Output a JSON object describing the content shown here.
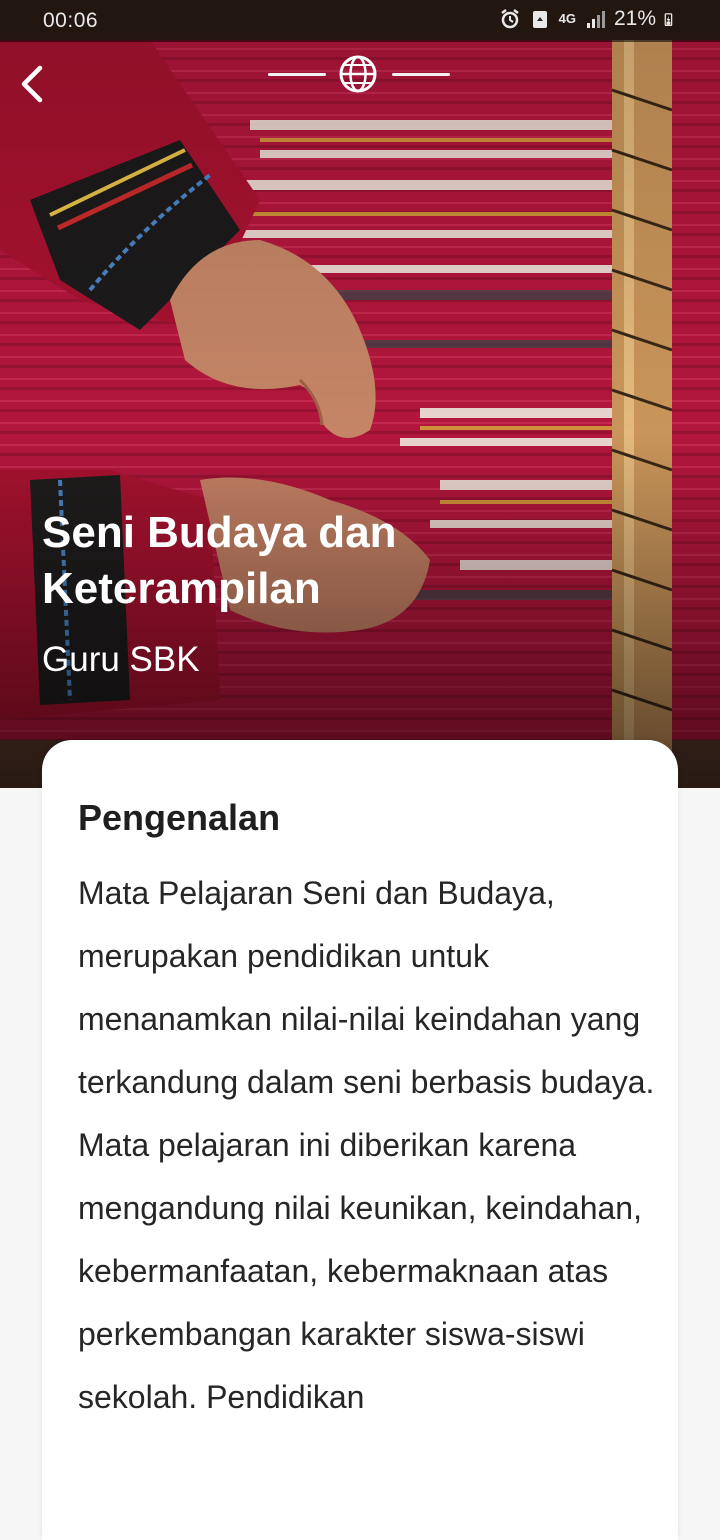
{
  "status_bar": {
    "time": "00:06",
    "network": "4G",
    "battery": "21%"
  },
  "header": {
    "back_icon": "chevron-left-icon",
    "language_icon": "globe-icon"
  },
  "hero": {
    "title": "Seni Budaya dan Keterampilan",
    "subtitle": "Guru SBK",
    "image": "weaving-loom-photo"
  },
  "card": {
    "heading": "Pengenalan",
    "body": "Mata Pelajaran Seni dan Budaya, merupakan pendidikan untuk menanamkan nilai-nilai keindahan yang terkandung dalam seni berbasis budaya. Mata pelajaran ini diberikan karena mengandung nilai keunikan, keindahan, kebermanfaatan, kebermaknaan atas perkembangan karakter siswa-siswi sekolah. Pendidikan"
  },
  "colors": {
    "textile_red": "#b0173a",
    "card_bg": "#ffffff",
    "page_bg": "#f6f6f6"
  }
}
